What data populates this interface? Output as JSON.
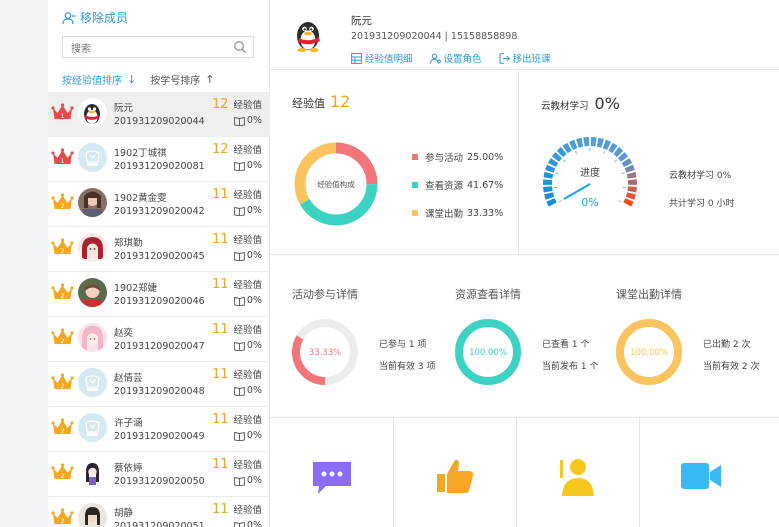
{
  "sidebar": {
    "remove_label": "移除成员",
    "search_placeholder": "搜索",
    "sort_exp": "按经验值排序",
    "sort_exp_arrow": "↓",
    "sort_id": "按学号排序",
    "sort_id_arrow": "↑",
    "members": [
      {
        "name": "阮元",
        "id": "201931209020044",
        "exp": "12",
        "exp_label": "经验值",
        "pct": "0%",
        "rank": "1",
        "crown": "red",
        "selected": true,
        "avatar": "penguin"
      },
      {
        "name": "1902丁城祺",
        "id": "201931209020081",
        "exp": "12",
        "exp_label": "经验值",
        "pct": "0%",
        "rank": "1",
        "crown": "red",
        "selected": false,
        "avatar": "default"
      },
      {
        "name": "1902黄金雯",
        "id": "201931209020042",
        "exp": "11",
        "exp_label": "经验值",
        "pct": "0%",
        "rank": "2",
        "crown": "orange",
        "selected": false,
        "avatar": "photo"
      },
      {
        "name": "郑琪勤",
        "id": "201931209020045",
        "exp": "11",
        "exp_label": "经验值",
        "pct": "0%",
        "rank": "2",
        "crown": "orange",
        "selected": false,
        "avatar": "anime-red"
      },
      {
        "name": "1902郑婕",
        "id": "201931209020046",
        "exp": "11",
        "exp_label": "经验值",
        "pct": "0%",
        "rank": "2",
        "crown": "orange",
        "selected": false,
        "avatar": "photo2"
      },
      {
        "name": "赵奕",
        "id": "201931209020047",
        "exp": "11",
        "exp_label": "经验值",
        "pct": "0%",
        "rank": "2",
        "crown": "orange",
        "selected": false,
        "avatar": "anime-pink"
      },
      {
        "name": "赵倩芸",
        "id": "201931209020048",
        "exp": "11",
        "exp_label": "经验值",
        "pct": "0%",
        "rank": "2",
        "crown": "orange",
        "selected": false,
        "avatar": "default"
      },
      {
        "name": "许子涵",
        "id": "201931209020049",
        "exp": "11",
        "exp_label": "经验值",
        "pct": "0%",
        "rank": "2",
        "crown": "orange",
        "selected": false,
        "avatar": "default"
      },
      {
        "name": "蔡依婷",
        "id": "201931209020050",
        "exp": "11",
        "exp_label": "经验值",
        "pct": "0%",
        "rank": "2",
        "crown": "orange",
        "selected": false,
        "avatar": "anime-girl"
      },
      {
        "name": "胡静",
        "id": "201931209020051",
        "exp": "11",
        "exp_label": "经验值",
        "pct": "0%",
        "rank": "2",
        "crown": "orange",
        "selected": false,
        "avatar": "photo3"
      }
    ]
  },
  "profile": {
    "name": "阮元",
    "ids": "201931209020044 | 15158858898",
    "link_exp": "经验值明细",
    "link_role": "设置角色",
    "link_remove": "移出班课"
  },
  "experience": {
    "title": "经验值",
    "value": "12",
    "donut_label": "经验值构成",
    "legend": [
      {
        "label": "参与活动",
        "value": "25.00%",
        "color": "#f2757a",
        "fraction": 0.25
      },
      {
        "label": "查看资源",
        "value": "41.67%",
        "color": "#3dd3c3",
        "fraction": 0.4167
      },
      {
        "label": "课堂出勤",
        "value": "33.33%",
        "color": "#fcc45e",
        "fraction": 0.3333
      }
    ]
  },
  "cloud": {
    "title": "云教材学习",
    "value": "0%",
    "gauge_label": "进度",
    "gauge_value": "0%",
    "info1": "云教材学习 0%",
    "info2": "共计学习 0 小时",
    "progress": 0
  },
  "details": [
    {
      "title": "活动参与详情",
      "ring_text": "33.33%",
      "color": "#f2757a",
      "text_color": "#f2757a",
      "fraction": 0.3333,
      "line1": "已参与 1 项",
      "line2": "当前有效 3 项"
    },
    {
      "title": "资源查看详情",
      "ring_text": "100.00%",
      "color": "#3dd3c3",
      "text_color": "#3dd3c3",
      "fraction": 1,
      "line1": "已查看 1 个",
      "line2": "当前发布 1 个"
    },
    {
      "title": "课堂出勤详情",
      "ring_text": "100.00%",
      "color": "#fcc45e",
      "text_color": "#fcc45e",
      "fraction": 1,
      "line1": "已出勤 2 次",
      "line2": "当前有效 2 次"
    }
  ],
  "tools": [
    {
      "label": "",
      "icon": "chat-icon",
      "color": "#8a6cf5"
    },
    {
      "label": "",
      "icon": "thumbs-up-icon",
      "color": "#f5a623"
    },
    {
      "label": "",
      "icon": "person-icon",
      "color": "#f7c71f"
    },
    {
      "label": "",
      "icon": "video-icon",
      "color": "#36b9f5"
    }
  ]
}
